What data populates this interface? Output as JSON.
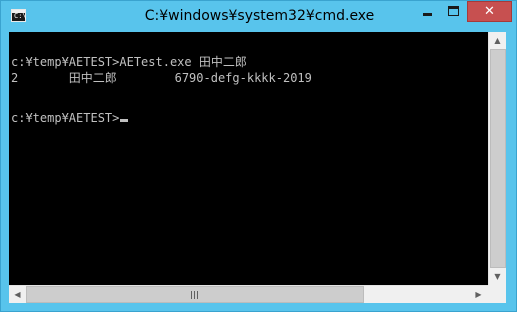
{
  "window": {
    "title": "C:¥windows¥system32¥cmd.exe",
    "app_icon_glyph": "C:\\",
    "close_glyph": "✕"
  },
  "console": {
    "lines": [
      "c:¥temp¥AETEST>AETest.exe 田中二郎",
      "2       田中二郎        6790-defg-kkkk-2019",
      "",
      "c:¥temp¥AETEST>"
    ],
    "cursor": "_"
  },
  "scrollbars": {
    "up_arrow": "▲",
    "down_arrow": "▼",
    "left_arrow": "◀",
    "right_arrow": "▶"
  },
  "icons": {
    "app": "cmd-app-icon",
    "minimize": "minimize-icon",
    "maximize": "maximize-icon",
    "close": "close-icon"
  },
  "colors": {
    "frame": "#58c4ec",
    "close_button": "#c75050",
    "console_background": "#000000",
    "console_text": "#c0c0c0"
  }
}
